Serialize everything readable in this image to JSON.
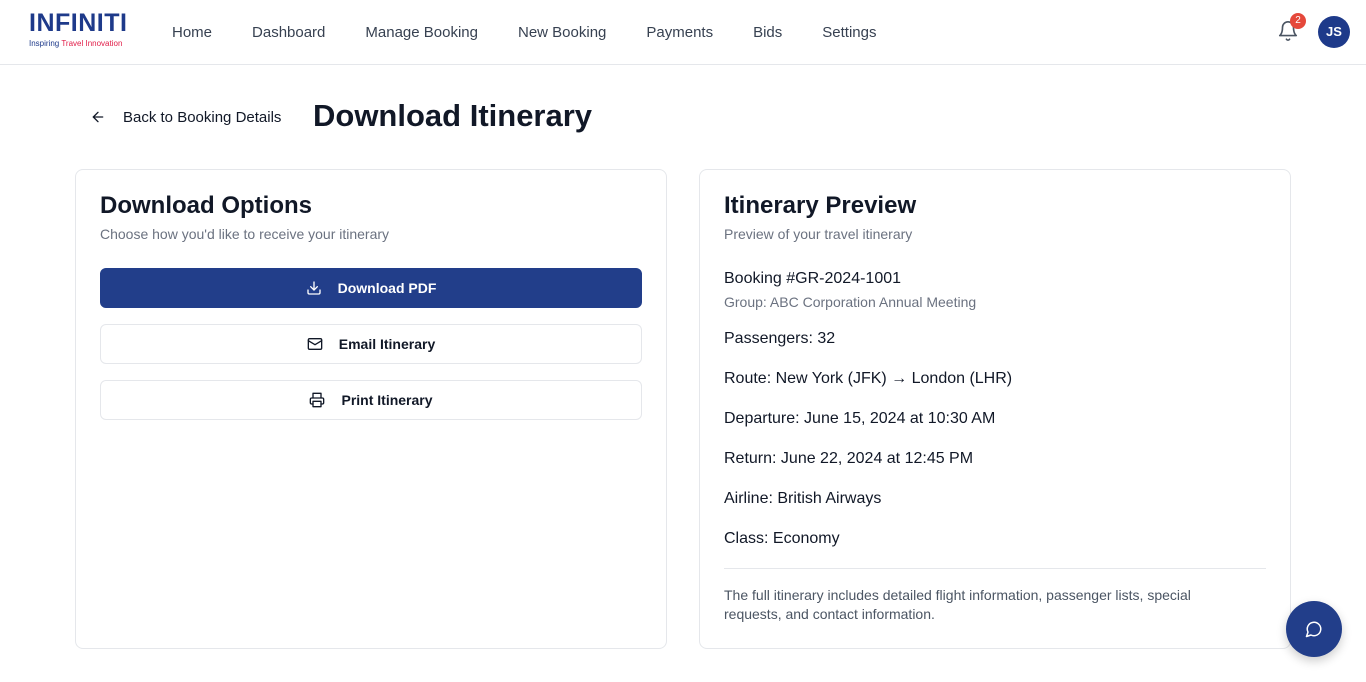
{
  "brand": {
    "name": "INFINITI",
    "tagline_prefix": "Inspiring ",
    "tagline_accent": "Travel Innovation",
    "color": "#1e3a8a",
    "accent_color": "#e11d48"
  },
  "nav": {
    "items": [
      {
        "label": "Home"
      },
      {
        "label": "Dashboard"
      },
      {
        "label": "Manage Booking"
      },
      {
        "label": "New Booking"
      },
      {
        "label": "Payments"
      },
      {
        "label": "Bids"
      },
      {
        "label": "Settings"
      }
    ]
  },
  "header": {
    "notification_icon": "bell-icon",
    "notification_count": "2",
    "user_initials": "JS"
  },
  "page": {
    "back_label": "Back to Booking Details",
    "title": "Download Itinerary"
  },
  "download_options": {
    "title": "Download Options",
    "subtitle": "Choose how you'd like to receive your itinerary",
    "buttons": {
      "pdf": {
        "label": "Download PDF",
        "icon": "download-icon"
      },
      "email": {
        "label": "Email Itinerary",
        "icon": "mail-icon"
      },
      "print": {
        "label": "Print Itinerary",
        "icon": "printer-icon"
      }
    },
    "primary_color": "#223e8a"
  },
  "preview": {
    "title": "Itinerary Preview",
    "subtitle": "Preview of your travel itinerary",
    "booking": "Booking #GR-2024-1001",
    "group": "Group: ABC Corporation Annual Meeting",
    "passengers": "Passengers: 32",
    "route": "Route: New York (JFK) → London (LHR)",
    "departure": "Departure: June 15, 2024 at 10:30 AM",
    "return": "Return: June 22, 2024 at 12:45 PM",
    "airline": "Airline: British Airways",
    "class": "Class: Economy",
    "note": "The full itinerary includes detailed flight information, passenger lists, special requests, and contact information."
  },
  "chat": {
    "icon": "chat-icon"
  }
}
